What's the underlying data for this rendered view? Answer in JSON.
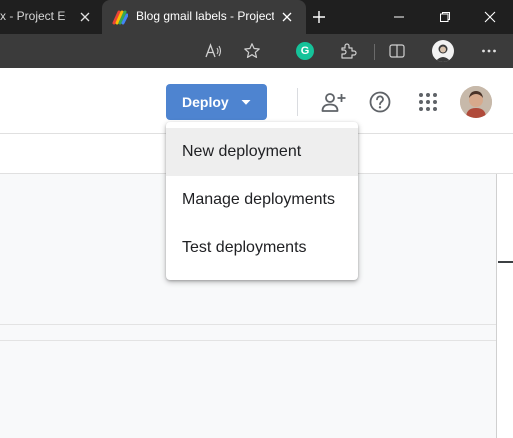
{
  "browser": {
    "tabs": [
      {
        "title": "x - Project Ed",
        "active": false
      },
      {
        "title": "Blog gmail labels - Project",
        "active": true
      }
    ],
    "window_controls": [
      "minimize-icon",
      "restore-icon",
      "close-icon"
    ],
    "toolbar_icons": [
      "read-aloud-icon",
      "favorite-star-icon",
      "grammarly-icon",
      "extensions-icon",
      "split-screen-icon",
      "profile-avatar",
      "more-menu-icon"
    ]
  },
  "header": {
    "deploy_label": "Deploy",
    "deploy_color": "#4e84d0",
    "icons": [
      "share-add-person-icon",
      "help-icon",
      "apps-grid-icon",
      "user-avatar"
    ]
  },
  "deploy_menu": {
    "items": [
      {
        "label": "New deployment",
        "highlighted": true
      },
      {
        "label": "Manage deployments",
        "highlighted": false
      },
      {
        "label": "Test deployments",
        "highlighted": false
      }
    ]
  }
}
